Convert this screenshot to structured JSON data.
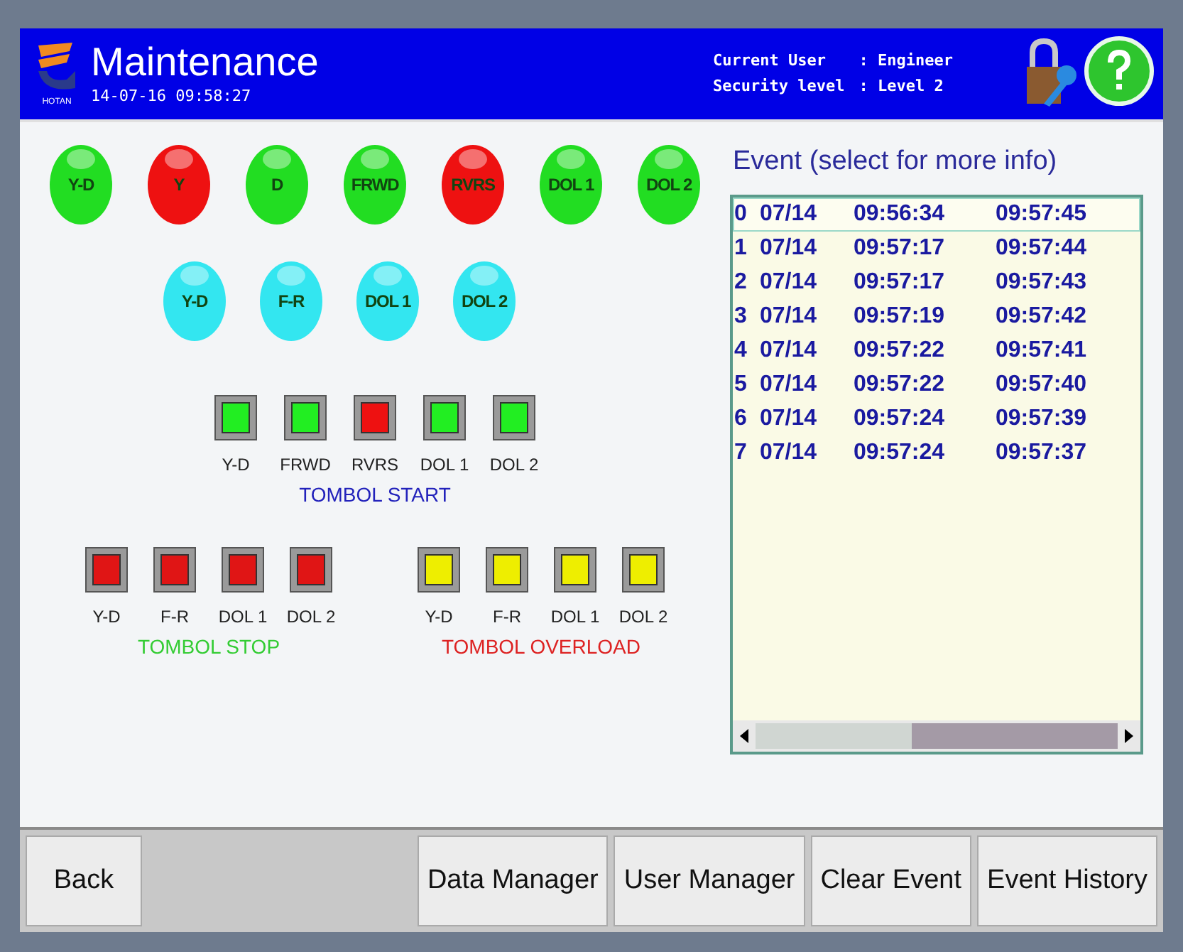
{
  "header": {
    "title": "Maintenance",
    "datetime": "14-07-16 09:58:27",
    "logo_caption": "HOTAN",
    "user_label": "Current User",
    "user_value": ": Engineer",
    "level_label": "Security level",
    "level_value": ": Level 2"
  },
  "lamps_top": [
    {
      "label": "Y-D",
      "color": "#22dd22"
    },
    {
      "label": "Y",
      "color": "#ee1111"
    },
    {
      "label": "D",
      "color": "#22dd22"
    },
    {
      "label": "FRWD",
      "color": "#22dd22"
    },
    {
      "label": "RVRS",
      "color": "#ee1111"
    },
    {
      "label": "DOL 1",
      "color": "#22dd22"
    },
    {
      "label": "DOL 2",
      "color": "#22dd22"
    }
  ],
  "lamps_bottom": [
    {
      "label": "Y-D",
      "color": "#33e6f0"
    },
    {
      "label": "F-R",
      "color": "#33e6f0"
    },
    {
      "label": "DOL 1",
      "color": "#33e6f0"
    },
    {
      "label": "DOL 2",
      "color": "#33e6f0"
    }
  ],
  "start_group": {
    "title": "TOMBOL START",
    "color": "#2222bb",
    "buttons": [
      {
        "label": "Y-D",
        "color": "#22ee22"
      },
      {
        "label": "FRWD",
        "color": "#22ee22"
      },
      {
        "label": "RVRS",
        "color": "#ee1111"
      },
      {
        "label": "DOL 1",
        "color": "#22ee22"
      },
      {
        "label": "DOL 2",
        "color": "#22ee22"
      }
    ]
  },
  "lower_groups": [
    {
      "title": "TOMBOL STOP",
      "color": "#33cc33",
      "buttons": [
        {
          "label": "Y-D",
          "color": "#e01515"
        },
        {
          "label": "F-R",
          "color": "#e01515"
        },
        {
          "label": "DOL 1",
          "color": "#e01515"
        },
        {
          "label": "DOL 2",
          "color": "#e01515"
        }
      ]
    },
    {
      "title": "TOMBOL OVERLOAD",
      "color": "#dd2222",
      "buttons": [
        {
          "label": "Y-D",
          "color": "#eeee00"
        },
        {
          "label": "F-R",
          "color": "#eeee00"
        },
        {
          "label": "DOL 1",
          "color": "#eeee00"
        },
        {
          "label": "DOL 2",
          "color": "#eeee00"
        }
      ]
    }
  ],
  "events": {
    "title": "Event (select for more info)",
    "rows": [
      {
        "index": "0",
        "date": "07/14",
        "time_1": "09:56:34",
        "time_2": "09:57:45",
        "selected": true
      },
      {
        "index": "1",
        "date": "07/14",
        "time_1": "09:57:17",
        "time_2": "09:57:44",
        "selected": false
      },
      {
        "index": "2",
        "date": "07/14",
        "time_1": "09:57:17",
        "time_2": "09:57:43",
        "selected": false
      },
      {
        "index": "3",
        "date": "07/14",
        "time_1": "09:57:19",
        "time_2": "09:57:42",
        "selected": false
      },
      {
        "index": "4",
        "date": "07/14",
        "time_1": "09:57:22",
        "time_2": "09:57:41",
        "selected": false
      },
      {
        "index": "5",
        "date": "07/14",
        "time_1": "09:57:22",
        "time_2": "09:57:40",
        "selected": false
      },
      {
        "index": "6",
        "date": "07/14",
        "time_1": "09:57:24",
        "time_2": "09:57:39",
        "selected": false
      },
      {
        "index": "7",
        "date": "07/14",
        "time_1": "09:57:24",
        "time_2": "09:57:37",
        "selected": false
      }
    ]
  },
  "footer_left": [
    "Back"
  ],
  "footer_right": [
    "Data Manager",
    "User Manager",
    "Clear Event",
    "Event History"
  ]
}
